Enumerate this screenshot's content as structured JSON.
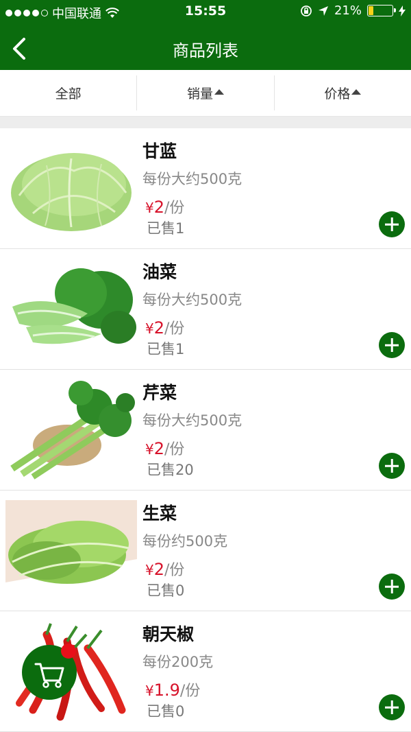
{
  "status": {
    "carrier": "中国联通",
    "time": "15:55",
    "battery": "21%",
    "battery_level": 0.21
  },
  "nav": {
    "title": "商品列表"
  },
  "filters": [
    {
      "label": "全部"
    },
    {
      "label": "销量"
    },
    {
      "label": "价格"
    }
  ],
  "products": [
    {
      "name": "甘蓝",
      "desc": "每份大约500克",
      "yen": "¥",
      "price": "2",
      "unit": "/份",
      "sold": "已售1",
      "image": "cabbage"
    },
    {
      "name": "油菜",
      "desc": "每份大约500克",
      "yen": "¥",
      "price": "2",
      "unit": "/份",
      "sold": "已售1",
      "image": "bok-choy"
    },
    {
      "name": "芹菜",
      "desc": "每份大约500克",
      "yen": "¥",
      "price": "2",
      "unit": "/份",
      "sold": "已售20",
      "image": "celery"
    },
    {
      "name": "生菜",
      "desc": "每份约500克",
      "yen": "¥",
      "price": "2",
      "unit": "/份",
      "sold": "已售0",
      "image": "lettuce"
    },
    {
      "name": "朝天椒",
      "desc": "每份200克",
      "yen": "¥",
      "price": "1.9",
      "unit": "/份",
      "sold": "已售0",
      "image": "chili-peppers"
    }
  ],
  "colors": {
    "brand": "#0b6c0e",
    "price": "#d7122a",
    "badge": "#e8101a",
    "battery": "#f7d21a"
  }
}
